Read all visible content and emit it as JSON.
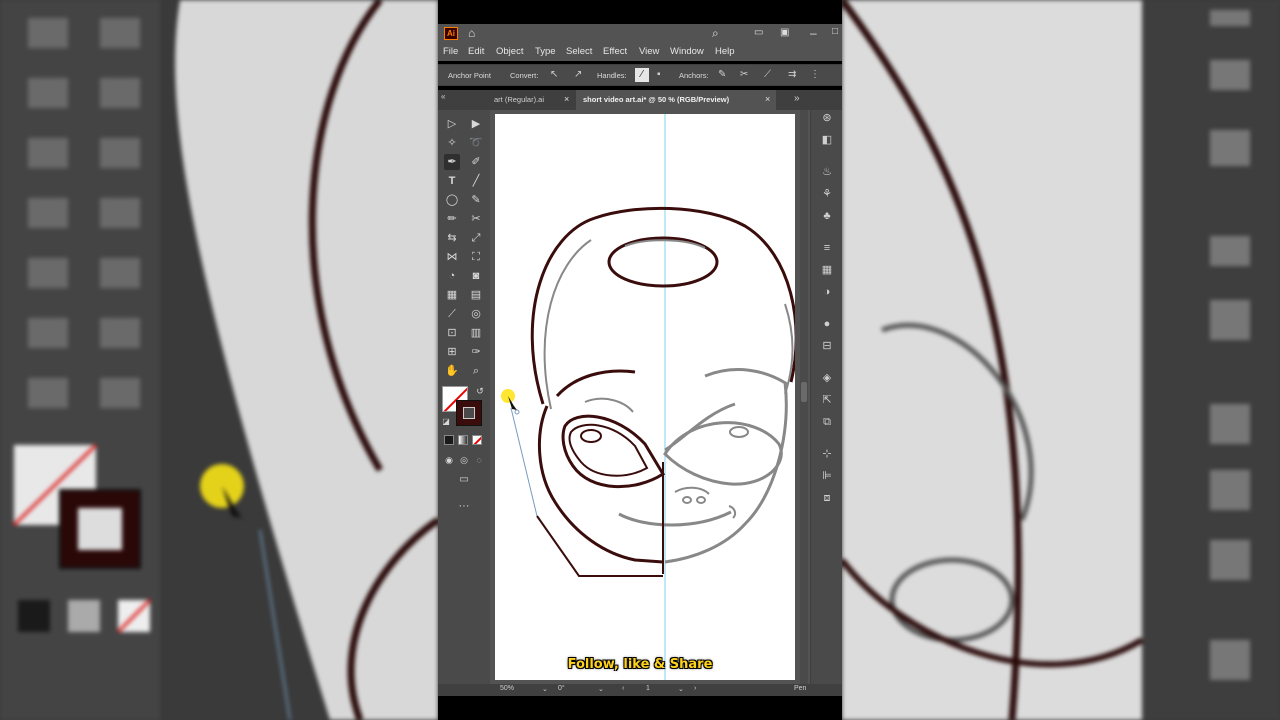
{
  "app": {
    "logo": "Ai",
    "colors": {
      "chrome": "#535353",
      "panel": "#4a4a4a",
      "artboard": "#ffffff",
      "accent_stroke": "#3a0c0c",
      "guide": "#7fd3f0",
      "caption": "#ffd21c"
    }
  },
  "menu": {
    "items": [
      "File",
      "Edit",
      "Object",
      "Type",
      "Select",
      "Effect",
      "View",
      "Window",
      "Help"
    ]
  },
  "control_bar": {
    "anchor_point": "Anchor Point",
    "convert": "Convert:",
    "handles": "Handles:",
    "anchors": "Anchors:"
  },
  "tabs": {
    "inactive": "art (Regular).ai",
    "active": "short video art.ai* @ 50 % (RGB/Preview)",
    "close": "×",
    "overflow": "»"
  },
  "toolbox": {
    "more": "···",
    "active_tool": "pen-tool"
  },
  "status": {
    "zoom": "50%",
    "rotation": "0°",
    "artboard": "1",
    "tool": "Pen"
  },
  "caption": "Follow, like & Share"
}
